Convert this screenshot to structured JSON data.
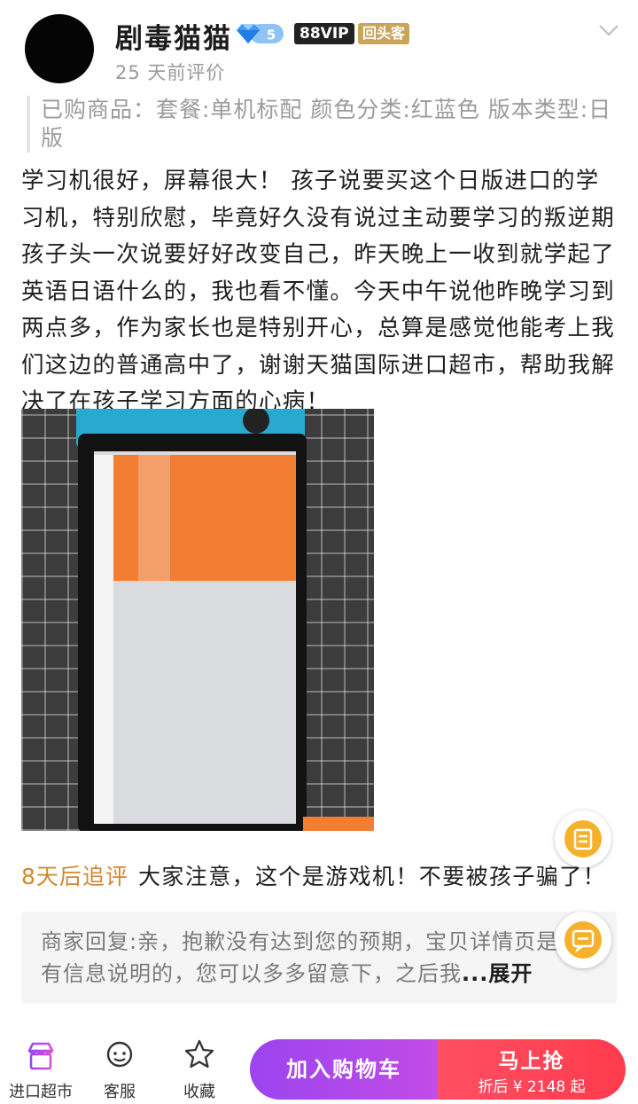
{
  "header": {
    "username": "剧毒猫猫",
    "level": "5",
    "vip_badge": "88VIP",
    "repeat_badge": "回头客",
    "review_time": "25 天前评价"
  },
  "purchased": {
    "text": "已购商品：套餐:单机标配  颜色分类:红蓝色  版本类型:日版"
  },
  "review": {
    "text": "学习机很好，屏幕很大！ 孩子说要买这个日版进口的学习机，特别欣慰，毕竟好久没有说过主动要学习的叛逆期孩子头一次说要好好改变自己，昨天晚上一收到就学起了英语日语什么的，我也看不懂。今天中午说他昨晚学习到两点多，作为家长也是特别开心，总算是感觉他能考上我们这边的普通高中了，谢谢天猫国际进口超市，帮助我解决了在孩子学习方面的心病！"
  },
  "followup": {
    "time_label": "8天后追评",
    "text": "大家注意，这个是游戏机！不要被孩子骗了！"
  },
  "merchant_reply": {
    "text": "商家回复:亲，抱歉没有达到您的预期，宝贝详情页是有信息说明的，您可以多多留意下，之后我",
    "ellipsis": "...",
    "expand_label": "展开"
  },
  "bottom_bar": {
    "tabs": [
      {
        "label": "进口超市",
        "icon": "store-icon"
      },
      {
        "label": "客服",
        "icon": "customer-service-icon"
      },
      {
        "label": "收藏",
        "icon": "star-icon"
      }
    ],
    "cart_label": "加入购物车",
    "buy_label": "马上抢",
    "buy_price": "折后 ¥ 2148 起"
  },
  "colors": {
    "accent_purple": "#9b44f0",
    "accent_red": "#ff3b4d",
    "followup_orange": "#d2882f",
    "badge_gold": "#c9a55c"
  }
}
